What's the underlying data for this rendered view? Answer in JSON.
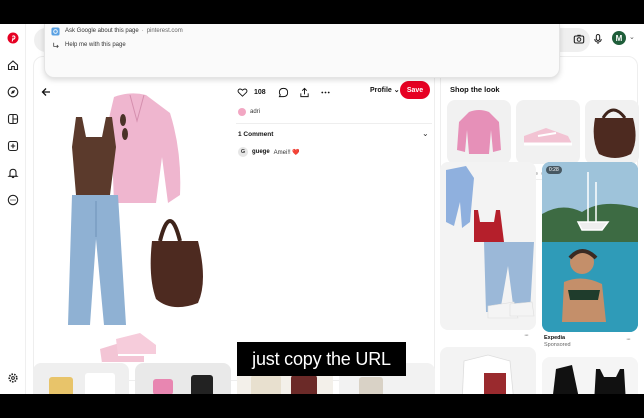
{
  "browser": {
    "suggestions": [
      {
        "label": "Ask Google about this page",
        "url": "pinterest.com",
        "icon": "google-lens-icon"
      },
      {
        "label": "Help me with this page",
        "icon": "arrow-return-icon"
      }
    ],
    "avatar_letter": "M"
  },
  "rail": {
    "items": [
      "pinterest-logo-icon",
      "home-icon",
      "explore-icon",
      "boards-icon",
      "create-icon",
      "notifications-icon",
      "messages-icon",
      "settings-icon"
    ],
    "brand_color": "#e60023"
  },
  "pin": {
    "like_count": "108",
    "profile_label": "Profile",
    "save_label": "Save",
    "author": "adri",
    "comments_header": "1 Comment",
    "comment": {
      "avatar": "G",
      "user": "guege",
      "text": "Amei!! ❤️"
    }
  },
  "caption": "just copy the URL",
  "shop": {
    "title": "Shop the look",
    "active_dot": 0,
    "dot_count": 4
  },
  "feed": {
    "video_duration": "0:28",
    "sponsor_name": "Expedia",
    "sponsor_label": "Sponsored"
  }
}
